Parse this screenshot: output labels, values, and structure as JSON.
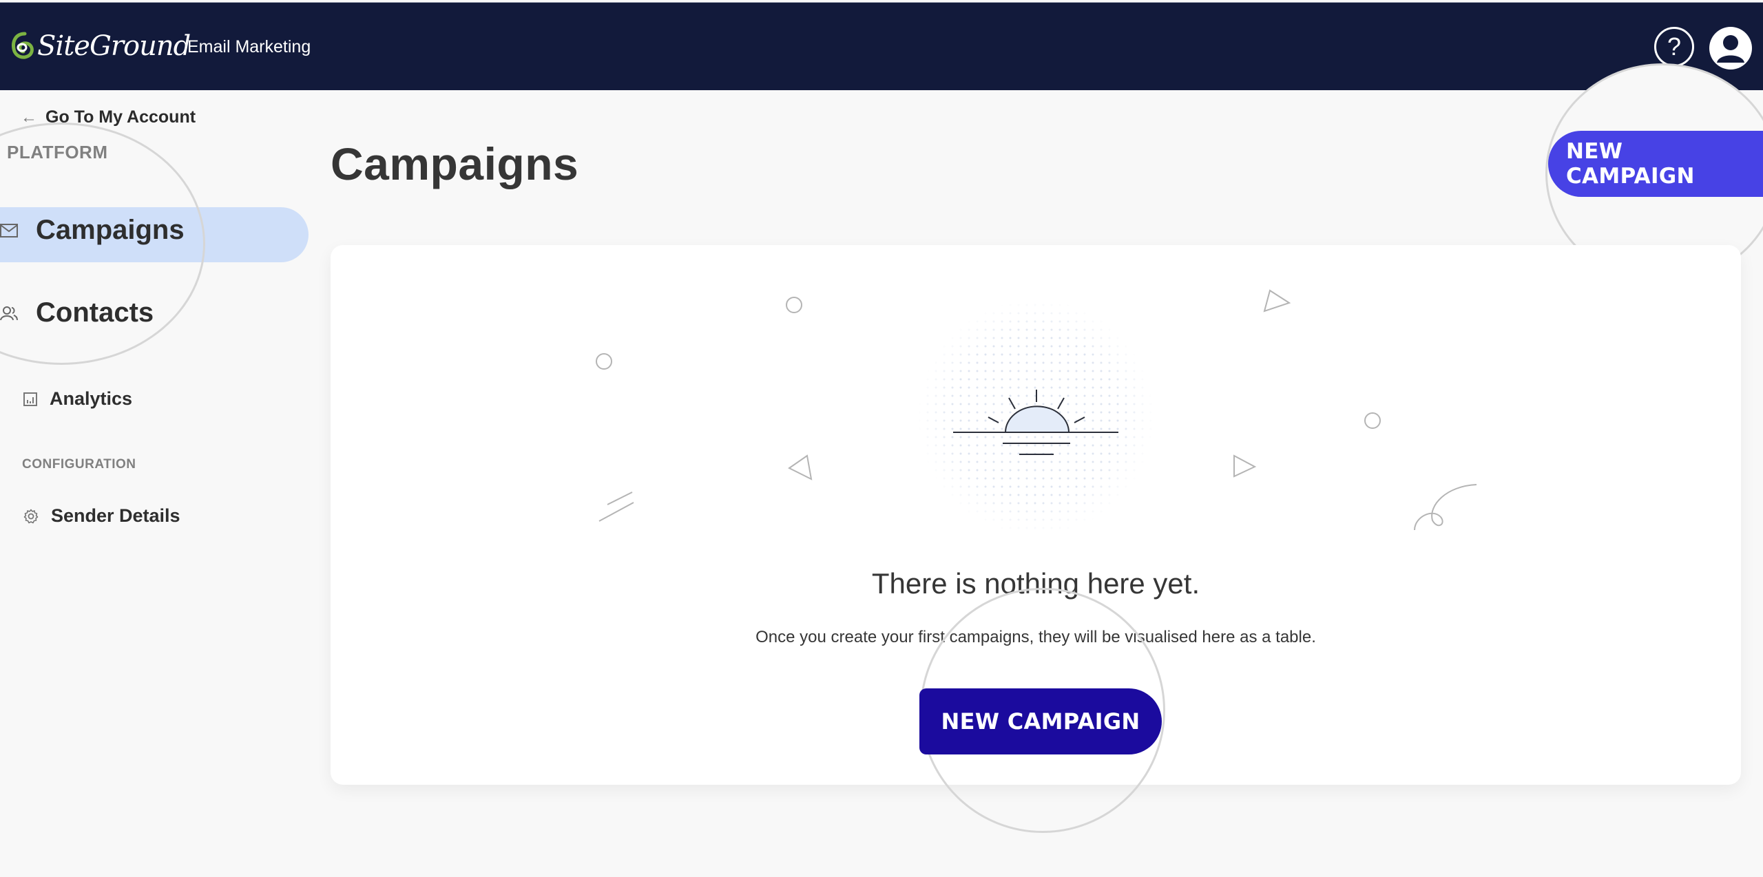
{
  "header": {
    "brand": "SiteGround",
    "app_name": "Email Marketing",
    "help_icon": "question-circle-icon",
    "account_icon": "user-avatar-icon"
  },
  "sidebar": {
    "back_link": "Go To My Account",
    "sections": [
      {
        "label": "PLATFORM",
        "items": [
          {
            "label": "Campaigns",
            "icon": "envelope-icon",
            "active": true
          },
          {
            "label": "Contacts",
            "icon": "users-icon",
            "active": false
          },
          {
            "label": "Analytics",
            "icon": "bar-chart-icon",
            "active": false
          }
        ]
      },
      {
        "label": "CONFIGURATION",
        "items": [
          {
            "label": "Sender Details",
            "icon": "gear-icon",
            "active": false
          }
        ]
      }
    ]
  },
  "main": {
    "title": "Campaigns",
    "new_campaign_label": "NEW CAMPAIGN",
    "empty_state": {
      "illustration": "sunrise-icon",
      "title": "There is nothing here yet.",
      "description": "Once you create your first campaigns, they will be visualised here as a table.",
      "button_label": "NEW CAMPAIGN"
    }
  },
  "colors": {
    "header_bg": "#121a3b",
    "brand_green": "#7cb342",
    "active_nav_bg": "#cfdff9",
    "primary_button": "#4742e5",
    "primary_button_pressed": "#1b0b9e",
    "page_bg": "#f8f8f8"
  }
}
